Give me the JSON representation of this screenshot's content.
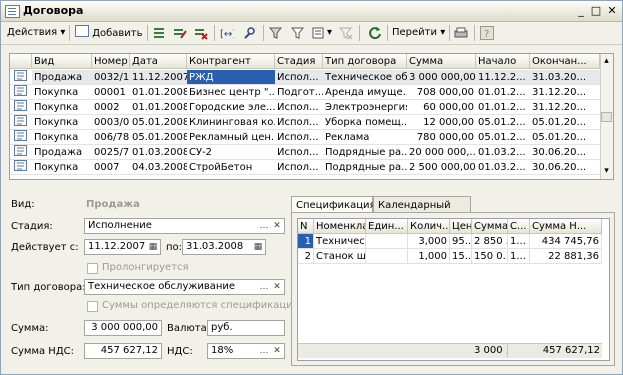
{
  "window": {
    "title": "Договора"
  },
  "toolbar": {
    "actions_label": "Действия",
    "add_label": "Добавить",
    "goto_label": "Перейти"
  },
  "grid": {
    "columns": [
      "Вид",
      "Номер",
      "Дата",
      "Контрагент",
      "Стадия",
      "Тип договора",
      "Сумма",
      "Начало",
      "Окончан...",
      "П..."
    ],
    "rows": [
      {
        "vid": "Продажа",
        "nomer": "0032/1",
        "data": "11.12.2007",
        "kontr": "РЖД",
        "stadia": "Испол...",
        "tip": "Техническое об...",
        "summa": "3 000 000,00",
        "nachalo": "11.12.2...",
        "okonch": "31.03.20...",
        "p": ""
      },
      {
        "vid": "Покупка",
        "nomer": "00001",
        "data": "01.01.2008",
        "kontr": "Бизнес центр \"...",
        "stadia": "Подгот...",
        "tip": "Аренда имуще...",
        "summa": "708 000,00",
        "nachalo": "01.01.2...",
        "okonch": "31.12.20...",
        "p": "✔"
      },
      {
        "vid": "Покупка",
        "nomer": "0002",
        "data": "01.01.2008",
        "kontr": "Городские эле...",
        "stadia": "Испол...",
        "tip": "Электроэнергия",
        "summa": "60 000,00",
        "nachalo": "01.01.2...",
        "okonch": "31.12.20...",
        "p": "✔"
      },
      {
        "vid": "Покупка",
        "nomer": "0003/0...",
        "data": "05.01.2008",
        "kontr": "Клининговая ко...",
        "stadia": "Испол...",
        "tip": "Уборка помещ...",
        "summa": "12 000,00",
        "nachalo": "05.01.2...",
        "okonch": "05.01.20...",
        "p": "✔"
      },
      {
        "vid": "Покупка",
        "nomer": "006/78",
        "data": "05.01.2008",
        "kontr": "Рекламный цен...",
        "stadia": "Испол...",
        "tip": "Реклама",
        "summa": "780 000,00",
        "nachalo": "05.01.2...",
        "okonch": "05.01.20...",
        "p": "✔"
      },
      {
        "vid": "Продажа",
        "nomer": "0025/7",
        "data": "01.03.2008",
        "kontr": "СУ-2",
        "stadia": "Испол...",
        "tip": "Подрядные ра...",
        "summa": "20 000 000,...",
        "nachalo": "01.03.2...",
        "okonch": "30.06.20...",
        "p": ""
      },
      {
        "vid": "Покупка",
        "nomer": "0007",
        "data": "04.03.2008",
        "kontr": "СтройБетон",
        "stadia": "Испол...",
        "tip": "Подрядные ра...",
        "summa": "2 500 000,00",
        "nachalo": "01.03.2...",
        "okonch": "30.06.20...",
        "p": ""
      }
    ]
  },
  "form": {
    "vid_label": "Вид:",
    "vid_value": "Продажа",
    "stadia_label": "Стадия:",
    "stadia_value": "Исполнение",
    "deistvuet_label": "Действует с:",
    "date_from": "11.12.2007",
    "po_label": "по:",
    "date_to": "31.03.2008",
    "prolong_label": "Пролонгируется",
    "tip_label": "Тип договора:",
    "tip_value": "Техническое обслуживание",
    "summy_label": "Суммы определяются спецификацией",
    "summa_label": "Сумма:",
    "summa_value": "3 000 000,00",
    "valuta_label": "Валюта:",
    "valuta_value": "руб.",
    "summa_nds_label": "Сумма НДС:",
    "summa_nds_value": "457 627,12",
    "nds_label": "НДС:",
    "nds_value": "18%"
  },
  "tabs": [
    "Спецификация",
    "Календарный план"
  ],
  "spec": {
    "columns": [
      "N",
      "Номенкла...",
      "Един...",
      "Колич...",
      "Цена",
      "Сумма",
      "С...",
      "Сумма Н..."
    ],
    "rows": [
      {
        "n": "1",
        "nom": "Техническ...",
        "ed": "",
        "kol": "3,000",
        "cena": "95...",
        "summa": "2 850 ...",
        "s": "1...",
        "snds": "434 745,76"
      },
      {
        "n": "2",
        "nom": "Станок шл...",
        "ed": "",
        "kol": "1,000",
        "cena": "15...",
        "summa": "150 0...",
        "s": "1...",
        "snds": "22 881,36"
      }
    ],
    "total_summa": "3 000 ...",
    "total_nds": "457 627,12"
  }
}
